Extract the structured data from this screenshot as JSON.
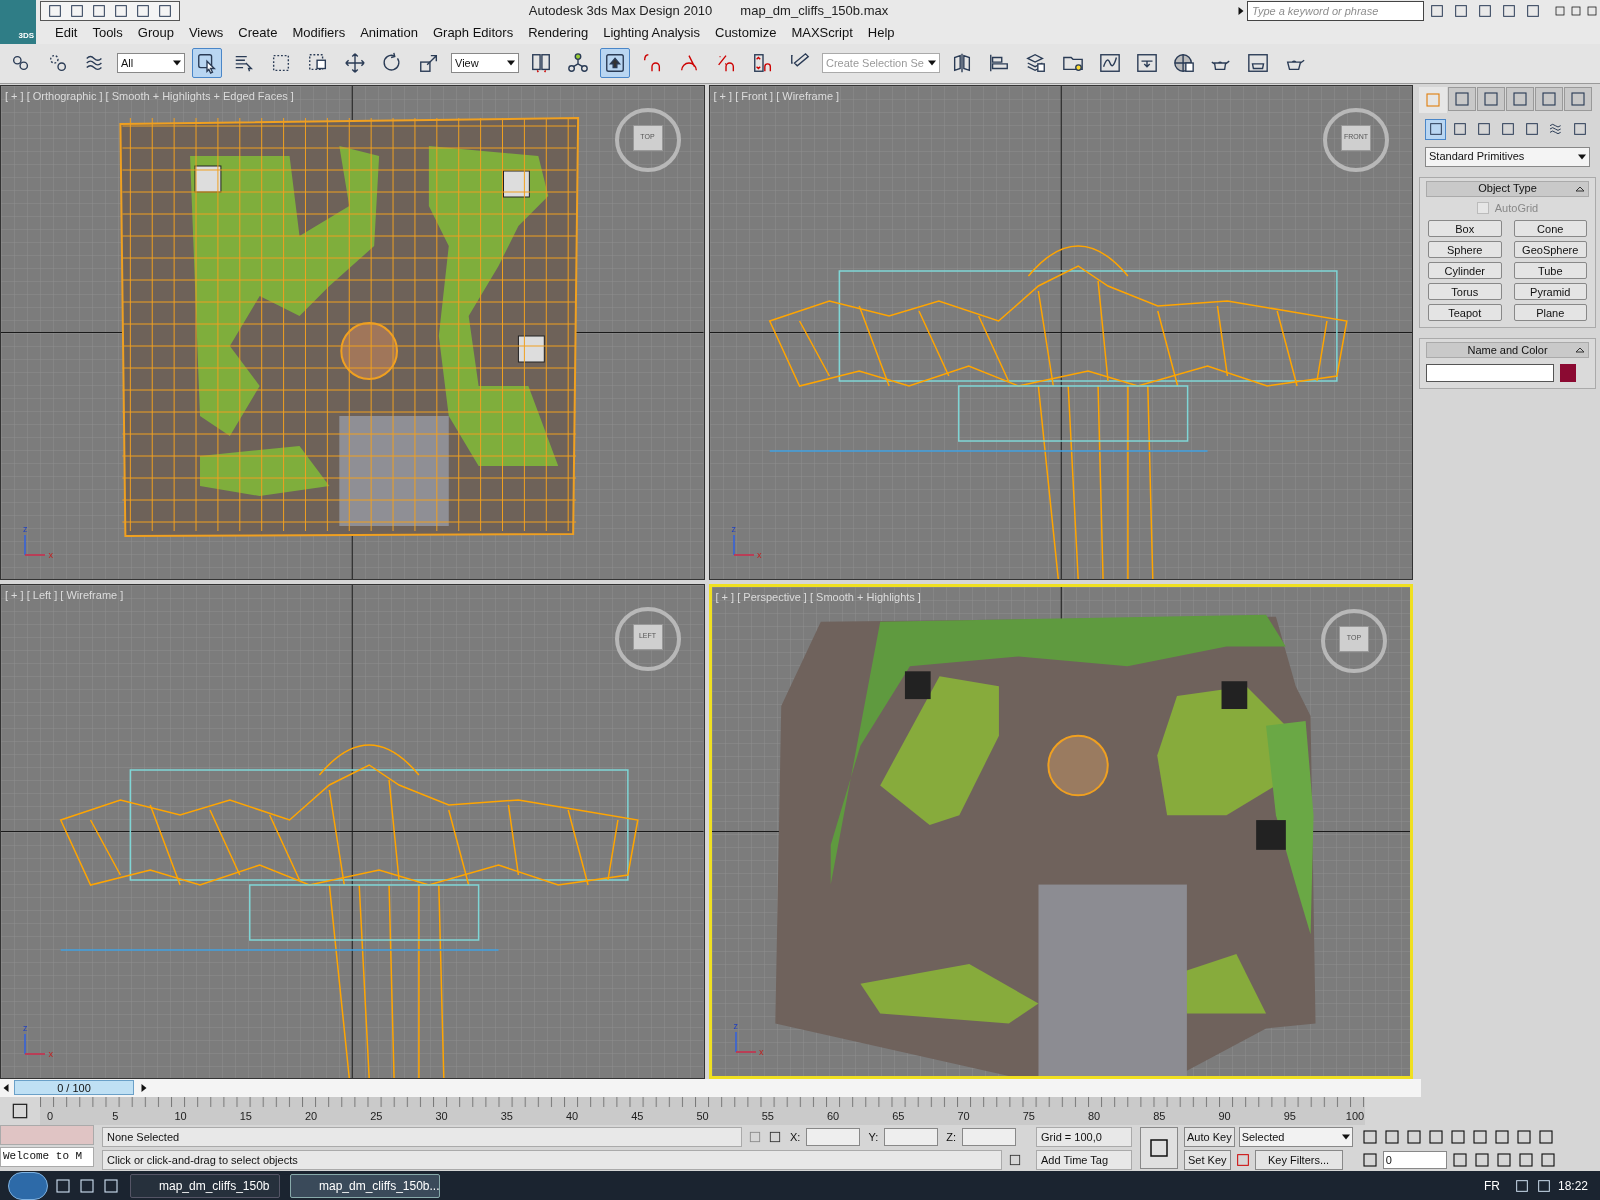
{
  "title_bar": {
    "app": "Autodesk 3ds Max Design 2010",
    "file": "map_dm_cliffs_150b.max",
    "logo": "3DS",
    "search_placeholder": "Type a keyword or phrase"
  },
  "menu": [
    "Edit",
    "Tools",
    "Group",
    "Views",
    "Create",
    "Modifiers",
    "Animation",
    "Graph Editors",
    "Rendering",
    "Lighting Analysis",
    "Customize",
    "MAXScript",
    "Help"
  ],
  "toolbar": [
    {
      "kind": "button",
      "selected": false
    },
    {
      "kind": "button",
      "selected": false
    },
    {
      "kind": "button",
      "selected": false
    },
    {
      "kind": "dropdown",
      "value": "All"
    },
    {
      "kind": "button",
      "selected": true
    },
    {
      "kind": "button",
      "selected": false
    },
    {
      "kind": "button",
      "selected": false
    },
    {
      "kind": "button",
      "selected": false
    },
    {
      "kind": "button",
      "selected": false
    },
    {
      "kind": "button",
      "selected": false
    },
    {
      "kind": "button",
      "selected": false
    },
    {
      "kind": "dropdown",
      "value": "View"
    },
    {
      "kind": "button",
      "selected": false
    },
    {
      "kind": "button",
      "selected": false
    },
    {
      "kind": "button",
      "selected": true
    },
    {
      "kind": "button",
      "selected": false
    },
    {
      "kind": "button",
      "selected": false
    },
    {
      "kind": "button",
      "selected": false
    },
    {
      "kind": "button",
      "selected": false
    },
    {
      "kind": "button",
      "selected": false
    },
    {
      "kind": "dropdown",
      "value": "Create Selection Se"
    },
    {
      "kind": "button",
      "selected": false
    },
    {
      "kind": "button",
      "selected": false
    },
    {
      "kind": "button",
      "selected": false
    },
    {
      "kind": "button",
      "selected": false
    },
    {
      "kind": "button",
      "selected": false
    },
    {
      "kind": "button",
      "selected": false
    },
    {
      "kind": "button",
      "selected": false
    },
    {
      "kind": "button",
      "selected": false
    },
    {
      "kind": "button",
      "selected": false
    },
    {
      "kind": "button",
      "selected": false
    }
  ],
  "viewports": [
    {
      "kind": "top",
      "label": "[ + ] [ Orthographic ] [ Smooth + Highlights + Edged Faces ]",
      "active": false,
      "cube_label": "TOP",
      "axis": [
        "z",
        "x"
      ]
    },
    {
      "kind": "front",
      "label": "[ + ] [ Front ] [ Wireframe ]",
      "active": false,
      "cube_label": "FRONT",
      "axis": [
        "z",
        "x"
      ]
    },
    {
      "kind": "left",
      "label": "[ + ] [ Left ] [ Wireframe ]",
      "active": false,
      "cube_label": "LEFT",
      "axis": [
        "z",
        "x"
      ]
    },
    {
      "kind": "perspective",
      "label": "[ + ] [ Perspective ] [ Smooth + Highlights ]",
      "active": true,
      "cube_label": "TOP",
      "axis": [
        "z",
        "x"
      ]
    }
  ],
  "command_panel": {
    "tabs": [
      {
        "selected": true
      },
      {
        "selected": false
      },
      {
        "selected": false
      },
      {
        "selected": false
      },
      {
        "selected": false
      },
      {
        "selected": false
      }
    ],
    "categories": [
      {
        "selected": true
      },
      {
        "selected": false
      },
      {
        "selected": false
      },
      {
        "selected": false
      },
      {
        "selected": false
      },
      {
        "selected": false
      },
      {
        "selected": false
      }
    ],
    "dropdown": "Standard Primitives",
    "object_type": {
      "title": "Object Type",
      "autogrid": {
        "label": "AutoGrid",
        "checked": false,
        "disabled": true
      },
      "buttons": [
        "Box",
        "Cone",
        "Sphere",
        "GeoSphere",
        "Cylinder",
        "Tube",
        "Torus",
        "Pyramid",
        "Teapot",
        "Plane"
      ]
    },
    "name_and_color": {
      "title": "Name and Color",
      "color": "#8b0a32"
    }
  },
  "time_slider": "0 / 100",
  "track_ticks": [
    "0",
    "5",
    "10",
    "15",
    "20",
    "25",
    "30",
    "35",
    "40",
    "45",
    "50",
    "55",
    "60",
    "65",
    "70",
    "75",
    "80",
    "85",
    "90",
    "95",
    "100"
  ],
  "status": {
    "listener": "Welcome to M",
    "selection": "None Selected",
    "prompt": "Click or click-and-drag to select objects",
    "x_label": "X:",
    "y_label": "Y:",
    "z_label": "Z:",
    "grid": "Grid = 100,0",
    "time_tag": "Add Time Tag",
    "auto_key": "Auto Key",
    "set_key": "Set Key",
    "key_mode": "Selected",
    "key_filters": "Key Filters...",
    "frame": "0"
  },
  "taskbar": {
    "items": [
      {
        "label": "map_dm_cliffs_150b",
        "selected": false
      },
      {
        "label": "map_dm_cliffs_150b...",
        "selected": true
      }
    ],
    "language": "FR",
    "clock": "18:22"
  }
}
